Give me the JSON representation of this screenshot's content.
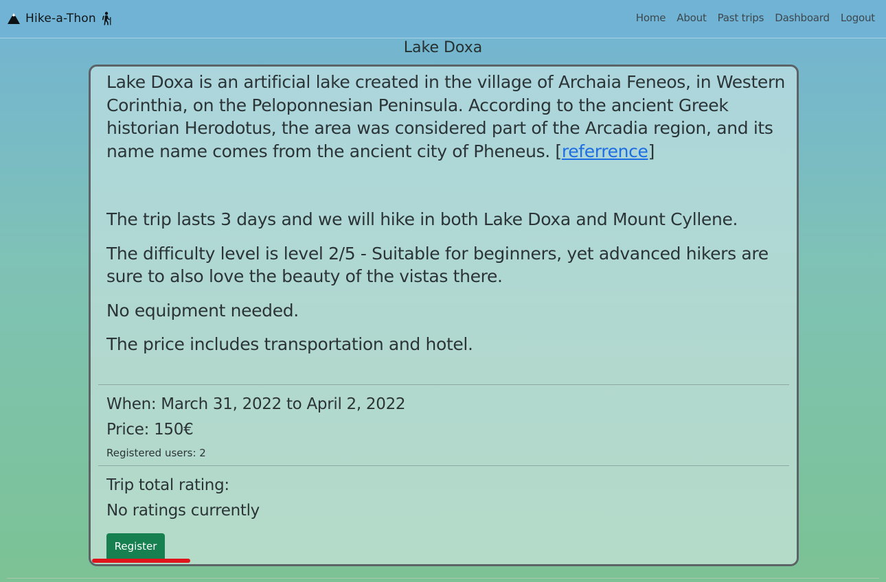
{
  "nav": {
    "brand": "Hike-a-Thon",
    "links": [
      "Home",
      "About",
      "Past trips",
      "Dashboard",
      "Logout"
    ]
  },
  "page": {
    "title": "Lake Doxa"
  },
  "trip": {
    "description": "Lake Doxa is an artificial lake created in the village of Archaia Feneos, in Western Corinthia, on the Peloponnesian Peninsula. According to the ancient Greek historian Herodotus, the area was considered part of the Arcadia region, and its name name comes from the ancient city of Pheneus. [",
    "reference_link": "referrence",
    "reference_close": "]",
    "days": "The trip lasts 3 days and we will hike in both Lake Doxa and Mount Cyllene.",
    "difficulty": "The difficulty level is level 2/5 - Suitable for beginners, yet advanced hikers are sure to also love the beauty of the vistas there.",
    "equipment": "No equipment needed.",
    "price_includes": "The price includes transportation and hotel.",
    "when": "When: March 31, 2022 to April 2, 2022",
    "price": "Price: 150€",
    "registered": "Registered users: 2",
    "rating_label": "Trip total rating:",
    "rating_value": "No ratings currently",
    "register_label": "Register"
  },
  "colors": {
    "navbar": "#70b3d5",
    "register_button": "#168050",
    "link": "#1d6ee3",
    "highlight_underline": "#e0141b"
  },
  "icons": [
    "mountain-icon",
    "hiker-icon"
  ]
}
